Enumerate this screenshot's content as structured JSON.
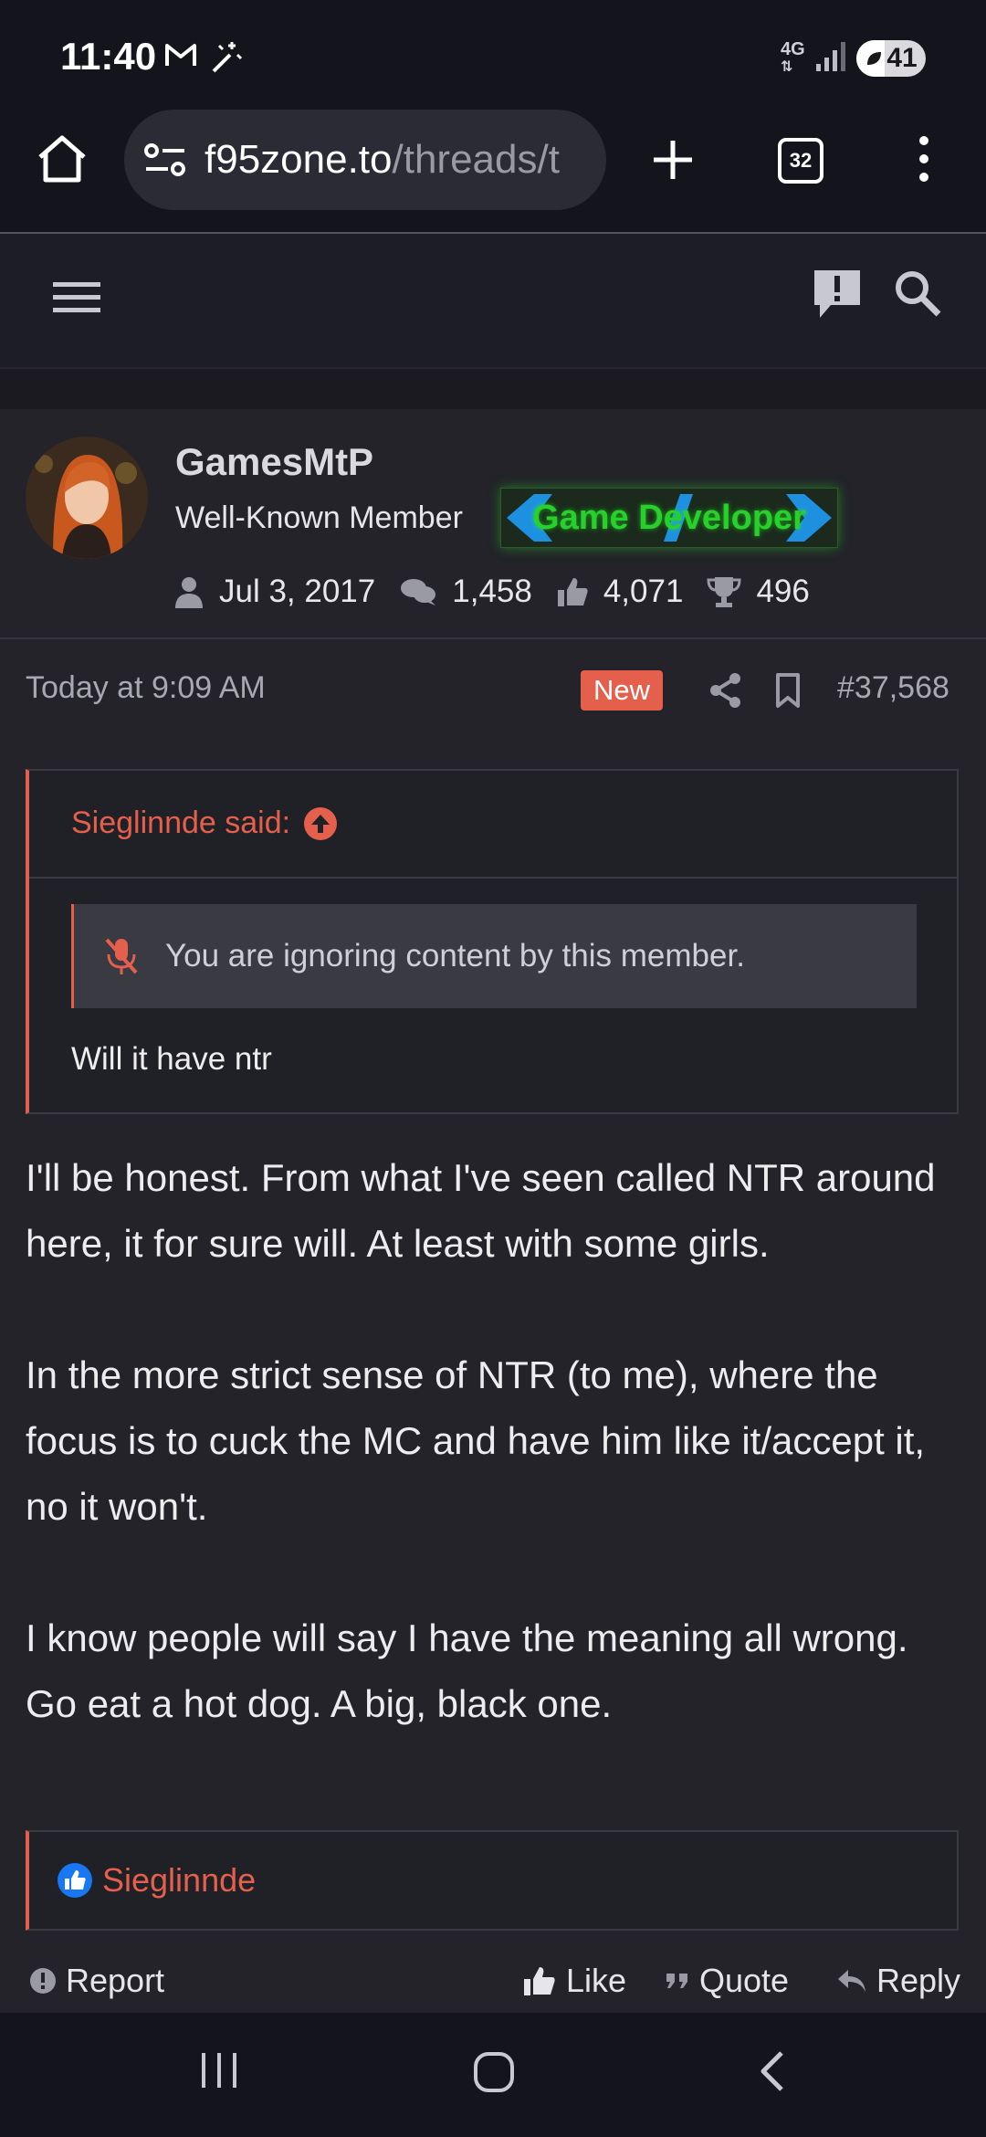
{
  "status_bar": {
    "time": "11:40",
    "network": "4G",
    "battery": "41",
    "battery_level": 0.41
  },
  "browser": {
    "url_host": "f95zone.to",
    "url_path": "/threads/t",
    "tab_count": "32"
  },
  "post": {
    "author": {
      "name": "GamesMtP",
      "title": "Well-Known Member",
      "badge": "Game Developer",
      "joined": "Jul 3, 2017",
      "messages": "1,458",
      "reactions": "4,071",
      "points": "496"
    },
    "timestamp": "Today at 9:09 AM",
    "new_label": "New",
    "number": "#37,568",
    "quote": {
      "author": "Sieglinnde said:",
      "ignored_notice": "You are ignoring content by this member.",
      "text": "Will it have ntr"
    },
    "paragraphs": [
      "I'll be honest. From what I've seen called NTR around here, it for sure will. At least with some girls.",
      "In the more strict sense of NTR (to me), where the focus is to cuck the MC and have him like it/accept it, no it won't.",
      "I know people will say I have the meaning all wrong. Go eat a hot dog. A big, black one."
    ],
    "reacted_by": "Sieglinnde",
    "actions": {
      "report": "Report",
      "like": "Like",
      "quote": "Quote",
      "reply": "Reply"
    }
  },
  "colors": {
    "accent": "#e4604c",
    "badge_green": "#27d02a",
    "badge_blue": "#1e90e0",
    "like_blue": "#1877f2"
  }
}
